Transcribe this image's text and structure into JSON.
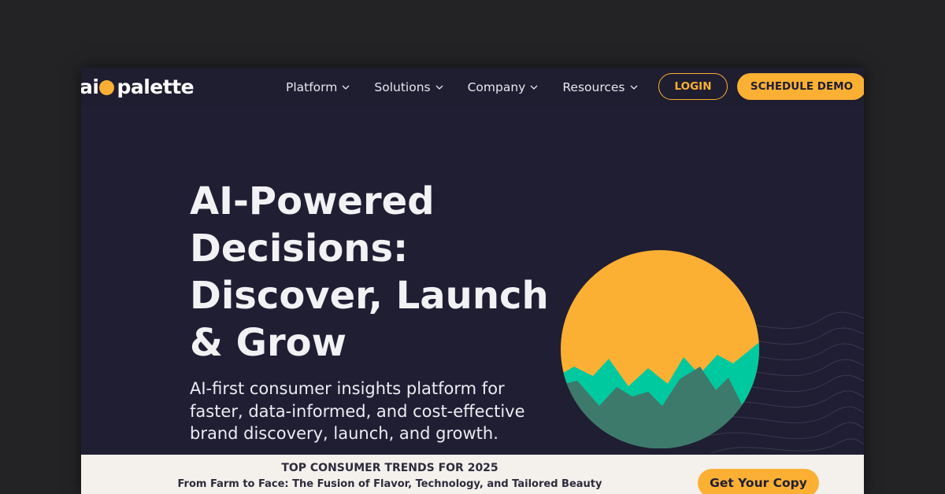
{
  "brand": {
    "logo_left": "ai",
    "logo_right": "palette",
    "accent": "#fbb034",
    "nav_bg": "#1f1d30",
    "hero_bg": "#201e33",
    "teal": "#00c9a0"
  },
  "nav": {
    "items": [
      {
        "label": "Platform"
      },
      {
        "label": "Solutions"
      },
      {
        "label": "Company"
      },
      {
        "label": "Resources"
      }
    ],
    "login_label": "LOGIN",
    "demo_label": "SCHEDULE DEMO"
  },
  "hero": {
    "title": "AI-Powered Decisions: Discover, Launch & Grow",
    "subtitle": "AI-first consumer insights platform for faster, data-informed, and cost-effective brand discovery, launch, and growth."
  },
  "promo": {
    "title": "TOP CONSUMER TRENDS FOR 2025",
    "subtitle": "From Farm to Face: The Fusion of Flavor, Technology, and Tailored Beauty",
    "cta_label": "Get Your Copy"
  }
}
